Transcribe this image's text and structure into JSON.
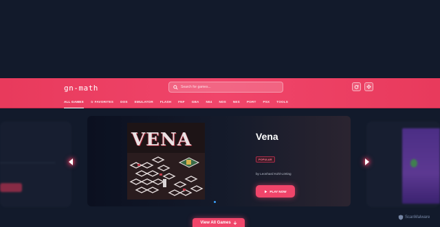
{
  "header": {
    "logo": "gn-math",
    "search_placeholder": "Search for games...",
    "icons": [
      "refresh-icon",
      "gear-icon"
    ]
  },
  "nav": {
    "items": [
      "ALL GAMES",
      "FAVORITES",
      "DOS",
      "EMULATOR",
      "FLASH",
      "FNF",
      "GBA",
      "N64",
      "NDS",
      "NES",
      "PORT",
      "PSX",
      "TOOLS"
    ],
    "active": "ALL GAMES"
  },
  "featured": {
    "title": "Vena",
    "art_title": "VENA",
    "badge": "POPULAR",
    "author": "by Leonhard Kohl-Lörting",
    "play_label": "PLAY NOW"
  },
  "view_all_label": "View All Games",
  "watermark": "ScanMalware",
  "colors": {
    "accent": "#f0456a",
    "background": "#121a2b"
  }
}
